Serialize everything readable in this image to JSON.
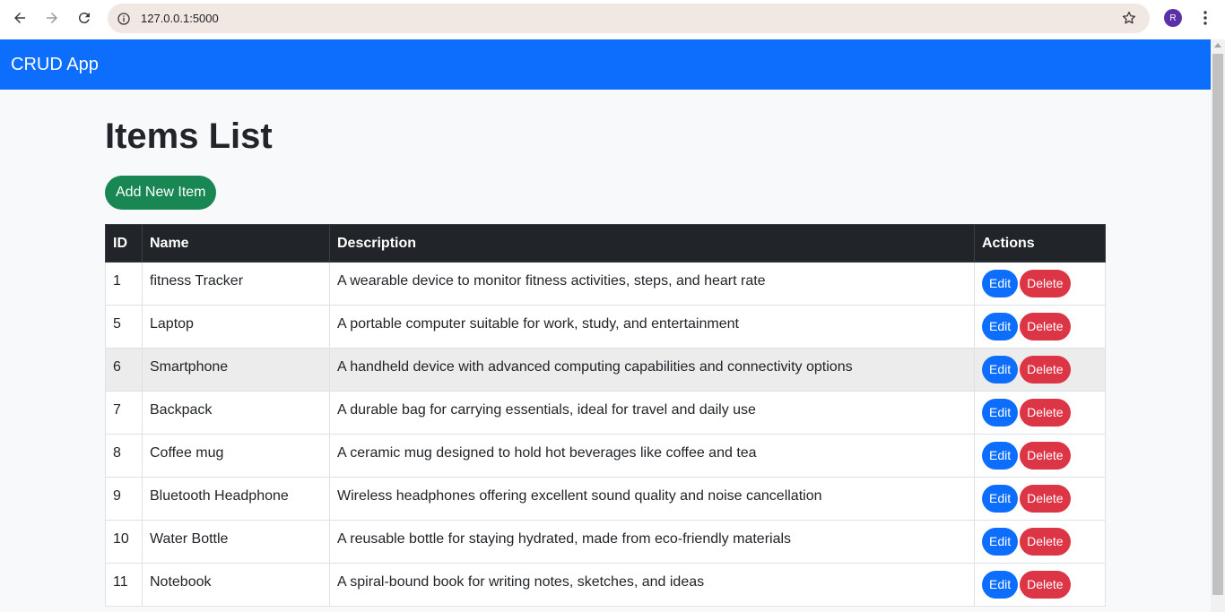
{
  "browser": {
    "url": "127.0.0.1:5000",
    "profile_initial": "R"
  },
  "app": {
    "brand": "CRUD App",
    "navbar_color": "#0d6efd"
  },
  "page": {
    "title": "Items List",
    "add_button": "Add New Item",
    "columns": [
      "ID",
      "Name",
      "Description",
      "Actions"
    ],
    "edit_label": "Edit",
    "delete_label": "Delete",
    "rows": [
      {
        "id": "1",
        "name": "fitness Tracker",
        "description": "A wearable device to monitor fitness activities, steps, and heart rate"
      },
      {
        "id": "5",
        "name": "Laptop",
        "description": "A portable computer suitable for work, study, and entertainment"
      },
      {
        "id": "6",
        "name": "Smartphone",
        "description": "A handheld device with advanced computing capabilities and connectivity options"
      },
      {
        "id": "7",
        "name": "Backpack",
        "description": "A durable bag for carrying essentials, ideal for travel and daily use"
      },
      {
        "id": "8",
        "name": "Coffee mug",
        "description": "A ceramic mug designed to hold hot beverages like coffee and tea"
      },
      {
        "id": "9",
        "name": "Bluetooth Headphone",
        "description": "Wireless headphones offering excellent sound quality and noise cancellation"
      },
      {
        "id": "10",
        "name": "Water Bottle",
        "description": "A reusable bottle for staying hydrated, made from eco-friendly materials"
      },
      {
        "id": "11",
        "name": "Notebook",
        "description": "A spiral-bound book for writing notes, sketches, and ideas"
      }
    ]
  }
}
